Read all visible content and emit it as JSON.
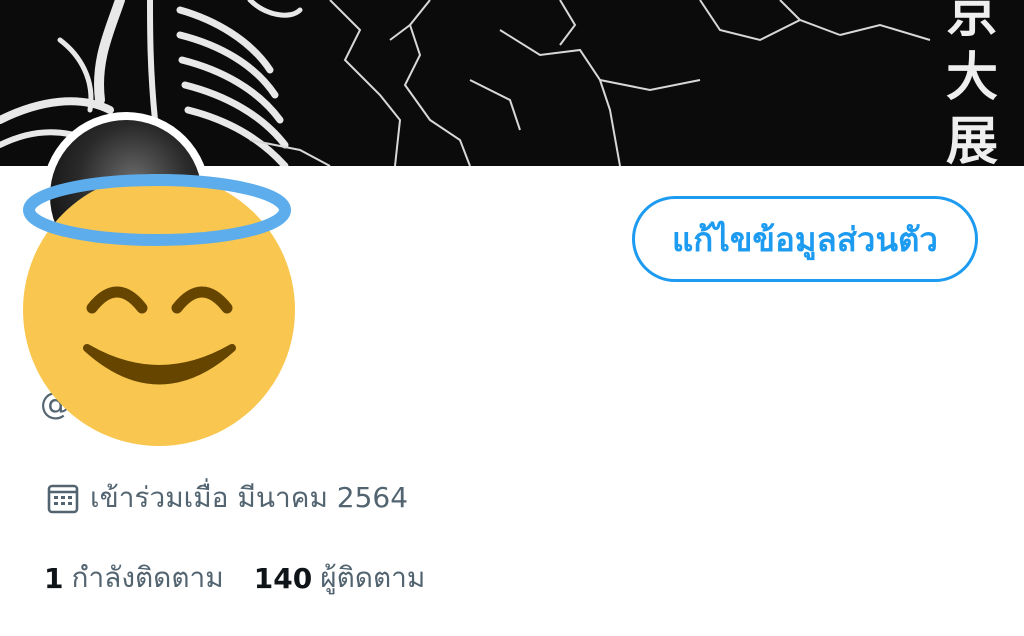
{
  "banner": {
    "kanji": "京大展"
  },
  "profile": {
    "edit_button_label": "แก้ไขข้อมูลส่วนตัว",
    "handle_visible": "@          vate",
    "joined_text": "เข้าร่วมเมื่อ มีนาคม 2564"
  },
  "stats": {
    "following_count": "1",
    "following_label": "กำลังติดตาม",
    "followers_count": "140",
    "followers_label": "ผู้ติดตาม"
  },
  "icons": {
    "calendar": "calendar-icon",
    "cover_emoji": "smiling-face-with-halo-icon"
  },
  "colors": {
    "accent": "#1d9bf0",
    "secondary_text": "#536471",
    "primary_text": "#0f1419",
    "banner_bg": "#0b0b0b",
    "emoji_face": "#f9c74f",
    "halo": "#5dadec"
  }
}
